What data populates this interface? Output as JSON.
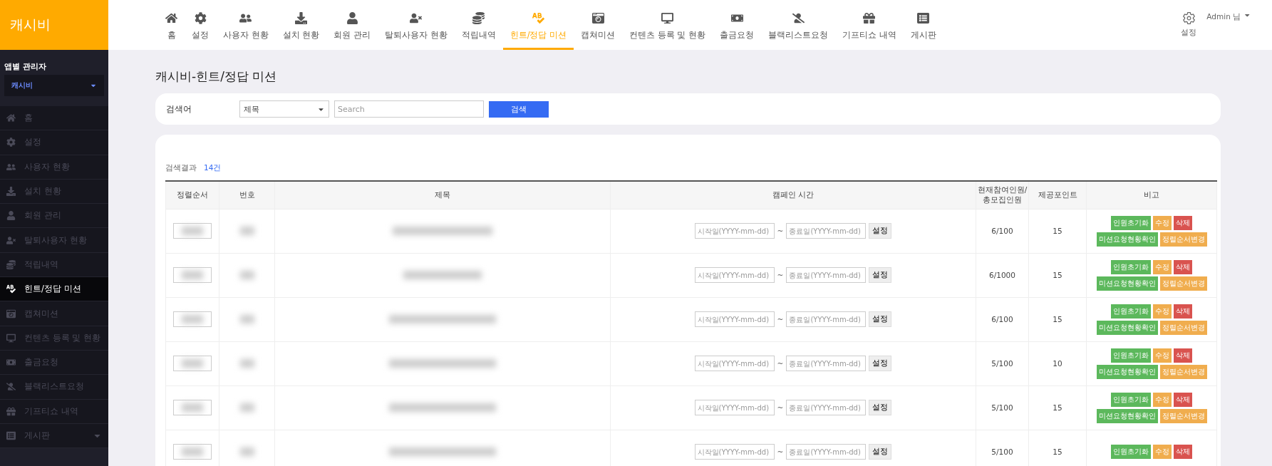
{
  "app": {
    "logo": "캐시비"
  },
  "top_nav": {
    "items": [
      {
        "label": "홈",
        "selected": false
      },
      {
        "label": "설정",
        "selected": false
      },
      {
        "label": "사용자 현황",
        "selected": false
      },
      {
        "label": "설치 현황",
        "selected": false
      },
      {
        "label": "회원 관리",
        "selected": false
      },
      {
        "label": "탈퇴사용자 현황",
        "selected": false
      },
      {
        "label": "적립내역",
        "selected": false
      },
      {
        "label": "힌트/정답 미션",
        "selected": true
      },
      {
        "label": "캡쳐미션",
        "selected": false
      },
      {
        "label": "컨텐츠 등록 및 현황",
        "selected": false
      },
      {
        "label": "출금요청",
        "selected": false
      },
      {
        "label": "블랙리스트요청",
        "selected": false
      },
      {
        "label": "기프티쇼 내역",
        "selected": false
      },
      {
        "label": "게시판",
        "selected": false
      }
    ]
  },
  "user_menu": {
    "settings_label": "설정",
    "user": "Admin 님"
  },
  "sidebar": {
    "title": "앱별 관리자",
    "app_select": "캐시비",
    "items": [
      {
        "label": "홈",
        "selected": false
      },
      {
        "label": "설정",
        "selected": false
      },
      {
        "label": "사용자 현황",
        "selected": false
      },
      {
        "label": "설치 현황",
        "selected": false
      },
      {
        "label": "회원 관리",
        "selected": false
      },
      {
        "label": "탈퇴사용자 현황",
        "selected": false
      },
      {
        "label": "적립내역",
        "selected": false
      },
      {
        "label": "힌트/정답 미션",
        "selected": true
      },
      {
        "label": "캡쳐미션",
        "selected": false
      },
      {
        "label": "컨텐츠 등록 및 현황",
        "selected": false
      },
      {
        "label": "출금요청",
        "selected": false
      },
      {
        "label": "블랙리스트요청",
        "selected": false
      },
      {
        "label": "기프티쇼 내역",
        "selected": false
      },
      {
        "label": "게시판",
        "selected": false,
        "expandable": true
      }
    ]
  },
  "page": {
    "title": "캐시비-힌트/정답 미션"
  },
  "search": {
    "label": "검색어",
    "field_select": "제목",
    "placeholder": "Search",
    "button": "검색"
  },
  "results": {
    "label": "검색결과",
    "count": "14건"
  },
  "table": {
    "columns": [
      "정렬순서",
      "번호",
      "제목",
      "캠페인 시간",
      "현재참여인원/\n총모집인원",
      "제공포인트",
      "비고"
    ],
    "rows": [
      {
        "start_placeholder": "시작일(YYYY-mm-dd)",
        "separator": "~",
        "end_placeholder": "종료일(YYYY-mm-dd)",
        "set_button": "설정",
        "participants": "6/100",
        "points": "15",
        "actions": [
          {
            "label": "인원초기화",
            "color": "#5cb85c"
          },
          {
            "label": "수정",
            "color": "#f0ad4e"
          },
          {
            "label": "삭제",
            "color": "#d9534f"
          },
          {
            "label": "미션요청현황확인",
            "color": "#5cb85c"
          },
          {
            "label": "정렬순서변경",
            "color": "#f0ad4e"
          }
        ]
      },
      {
        "start_placeholder": "시작일(YYYY-mm-dd)",
        "separator": "~",
        "end_placeholder": "종료일(YYYY-mm-dd)",
        "set_button": "설정",
        "participants": "6/1000",
        "points": "15",
        "actions": [
          {
            "label": "인원초기화",
            "color": "#5cb85c"
          },
          {
            "label": "수정",
            "color": "#f0ad4e"
          },
          {
            "label": "삭제",
            "color": "#d9534f"
          },
          {
            "label": "미션요청현황확인",
            "color": "#5cb85c"
          },
          {
            "label": "정렬순서변경",
            "color": "#f0ad4e"
          }
        ]
      },
      {
        "start_placeholder": "시작일(YYYY-mm-dd)",
        "separator": "~",
        "end_placeholder": "종료일(YYYY-mm-dd)",
        "set_button": "설정",
        "participants": "6/100",
        "points": "15",
        "actions": [
          {
            "label": "인원초기화",
            "color": "#5cb85c"
          },
          {
            "label": "수정",
            "color": "#f0ad4e"
          },
          {
            "label": "삭제",
            "color": "#d9534f"
          },
          {
            "label": "미션요청현황확인",
            "color": "#5cb85c"
          },
          {
            "label": "정렬순서변경",
            "color": "#f0ad4e"
          }
        ]
      },
      {
        "start_placeholder": "시작일(YYYY-mm-dd)",
        "separator": "~",
        "end_placeholder": "종료일(YYYY-mm-dd)",
        "set_button": "설정",
        "participants": "5/100",
        "points": "10",
        "actions": [
          {
            "label": "인원초기화",
            "color": "#5cb85c"
          },
          {
            "label": "수정",
            "color": "#f0ad4e"
          },
          {
            "label": "삭제",
            "color": "#d9534f"
          },
          {
            "label": "미션요청현황확인",
            "color": "#5cb85c"
          },
          {
            "label": "정렬순서변경",
            "color": "#f0ad4e"
          }
        ]
      },
      {
        "start_placeholder": "시작일(YYYY-mm-dd)",
        "separator": "~",
        "end_placeholder": "종료일(YYYY-mm-dd)",
        "set_button": "설정",
        "participants": "5/100",
        "points": "15",
        "actions": [
          {
            "label": "인원초기화",
            "color": "#5cb85c"
          },
          {
            "label": "수정",
            "color": "#f0ad4e"
          },
          {
            "label": "삭제",
            "color": "#d9534f"
          },
          {
            "label": "미션요청현황확인",
            "color": "#5cb85c"
          },
          {
            "label": "정렬순서변경",
            "color": "#f0ad4e"
          }
        ]
      },
      {
        "start_placeholder": "시작일(YYYY-mm-dd)",
        "separator": "~",
        "end_placeholder": "종료일(YYYY-mm-dd)",
        "set_button": "설정",
        "participants": "5/100",
        "points": "15",
        "actions": [
          {
            "label": "인원초기화",
            "color": "#5cb85c"
          },
          {
            "label": "수정",
            "color": "#f0ad4e"
          },
          {
            "label": "삭제",
            "color": "#d9534f"
          }
        ]
      }
    ]
  }
}
